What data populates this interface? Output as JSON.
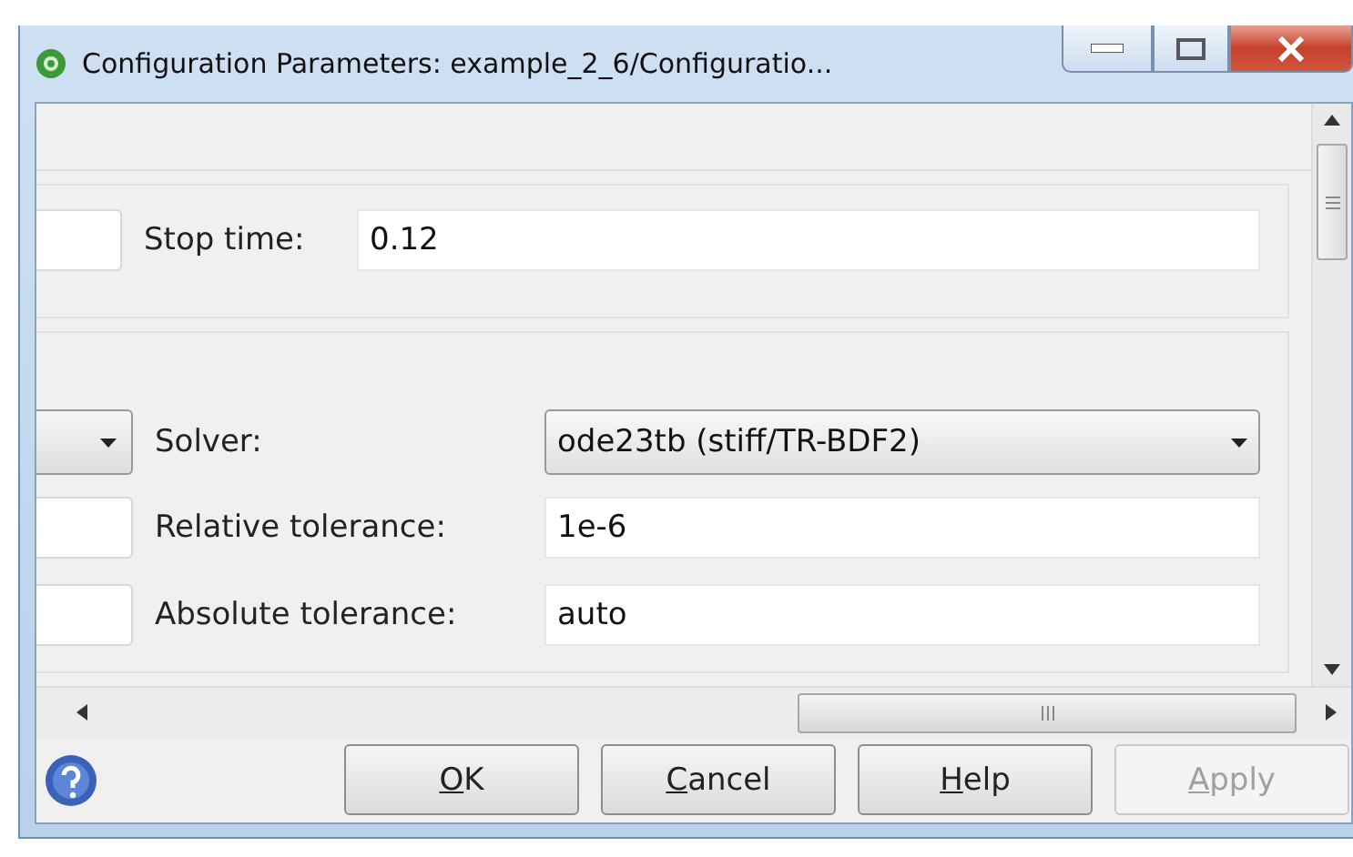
{
  "window": {
    "title": "Configuration Parameters: example_2_6/Configuratio..."
  },
  "time_group": {
    "rows": [
      {
        "label": "Stop time:",
        "kind": "input",
        "value": "0.12"
      }
    ]
  },
  "solver_group": {
    "rows": [
      {
        "label": "Solver:",
        "kind": "dropdown",
        "value": "ode23tb (stiff/TR-BDF2)"
      },
      {
        "label": "Relative tolerance:",
        "kind": "input",
        "value": "1e-6"
      },
      {
        "label": "Absolute tolerance:",
        "kind": "input",
        "value": "auto"
      }
    ]
  },
  "buttons": [
    {
      "label": "OK",
      "disabled": false
    },
    {
      "label": "Cancel",
      "disabled": false
    },
    {
      "label": "Help",
      "disabled": false
    },
    {
      "label": "Apply",
      "disabled": true
    }
  ]
}
